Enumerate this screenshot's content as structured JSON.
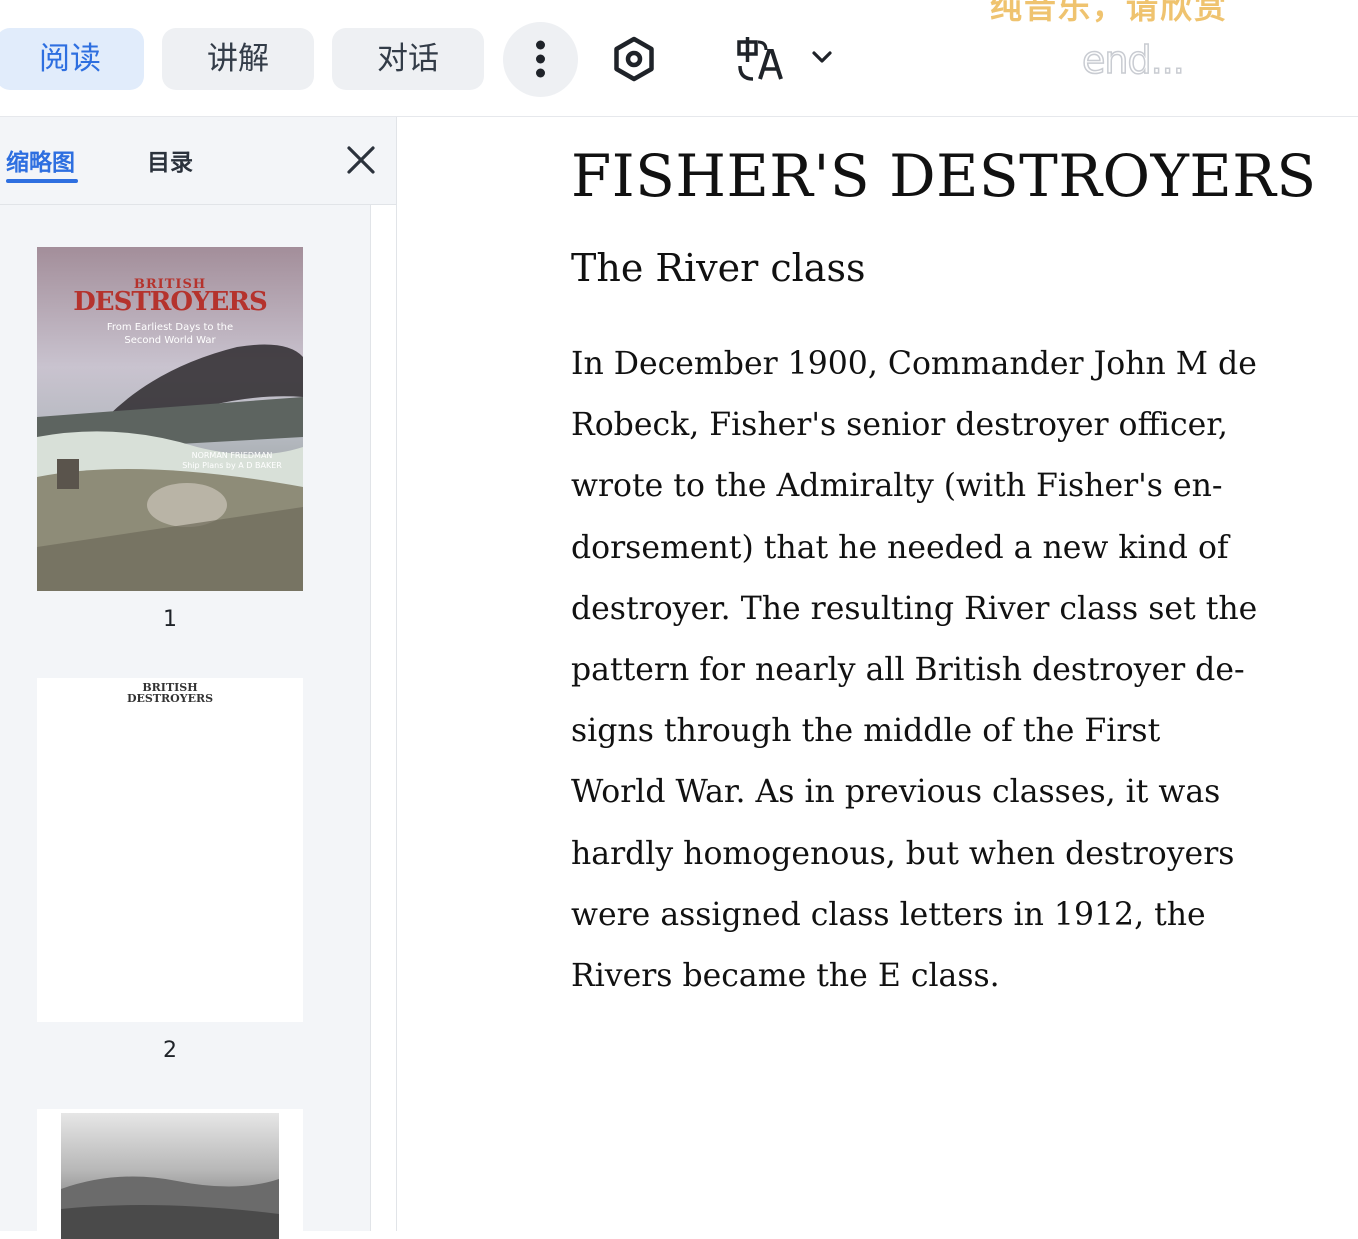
{
  "toolbar": {
    "tabs": [
      {
        "label": "阅读",
        "active": true
      },
      {
        "label": "讲解",
        "active": false
      },
      {
        "label": "对话",
        "active": false
      }
    ],
    "more_icon": "vertical-dots-icon",
    "settings_icon": "hexagon-settings-icon",
    "translate_icon": "translate-icon",
    "dropdown_icon": "chevron-down-icon",
    "banner_text": "纯音乐，请欣赏",
    "banner_subtext": "end..."
  },
  "sidebar": {
    "tabs": [
      {
        "label": "缩略图",
        "active": true
      },
      {
        "label": "目录",
        "active": false
      }
    ],
    "close_icon": "close-icon",
    "thumbnails": [
      {
        "page": "1",
        "cover_small": "BRITISH",
        "cover_big": "DESTROYERS",
        "cover_sub": "From Earliest Days to the\nSecond World War",
        "cover_author": "NORMAN FRIEDMAN\nShip Plans by A D BAKER"
      },
      {
        "page": "2",
        "title": "BRITISH\nDESTROYERS"
      }
    ]
  },
  "reader": {
    "chapter_title": "FISHER'S DESTROYERS",
    "section_title": "The River class",
    "lines": [
      "In December 1900, Commander John M de",
      "Robeck, Fisher's senior destroyer officer,",
      "wrote to the Admiralty (with Fisher's en-",
      "dorsement) that he needed a new kind of",
      "destroyer. The resulting River class set the",
      "pattern for nearly all British destroyer de-",
      "signs through the middle of the First",
      "World War. As in previous classes, it was",
      "hardly homogenous, but when destroyers",
      "were assigned class letters in 1912, the",
      "Rivers became the E class."
    ]
  },
  "colors": {
    "accent": "#2e6fe0",
    "active_tab_bg": "#e1ecfb",
    "tab_bg": "#eef0f3",
    "banner": "#efc36f",
    "cover_red": "#b5332d"
  }
}
